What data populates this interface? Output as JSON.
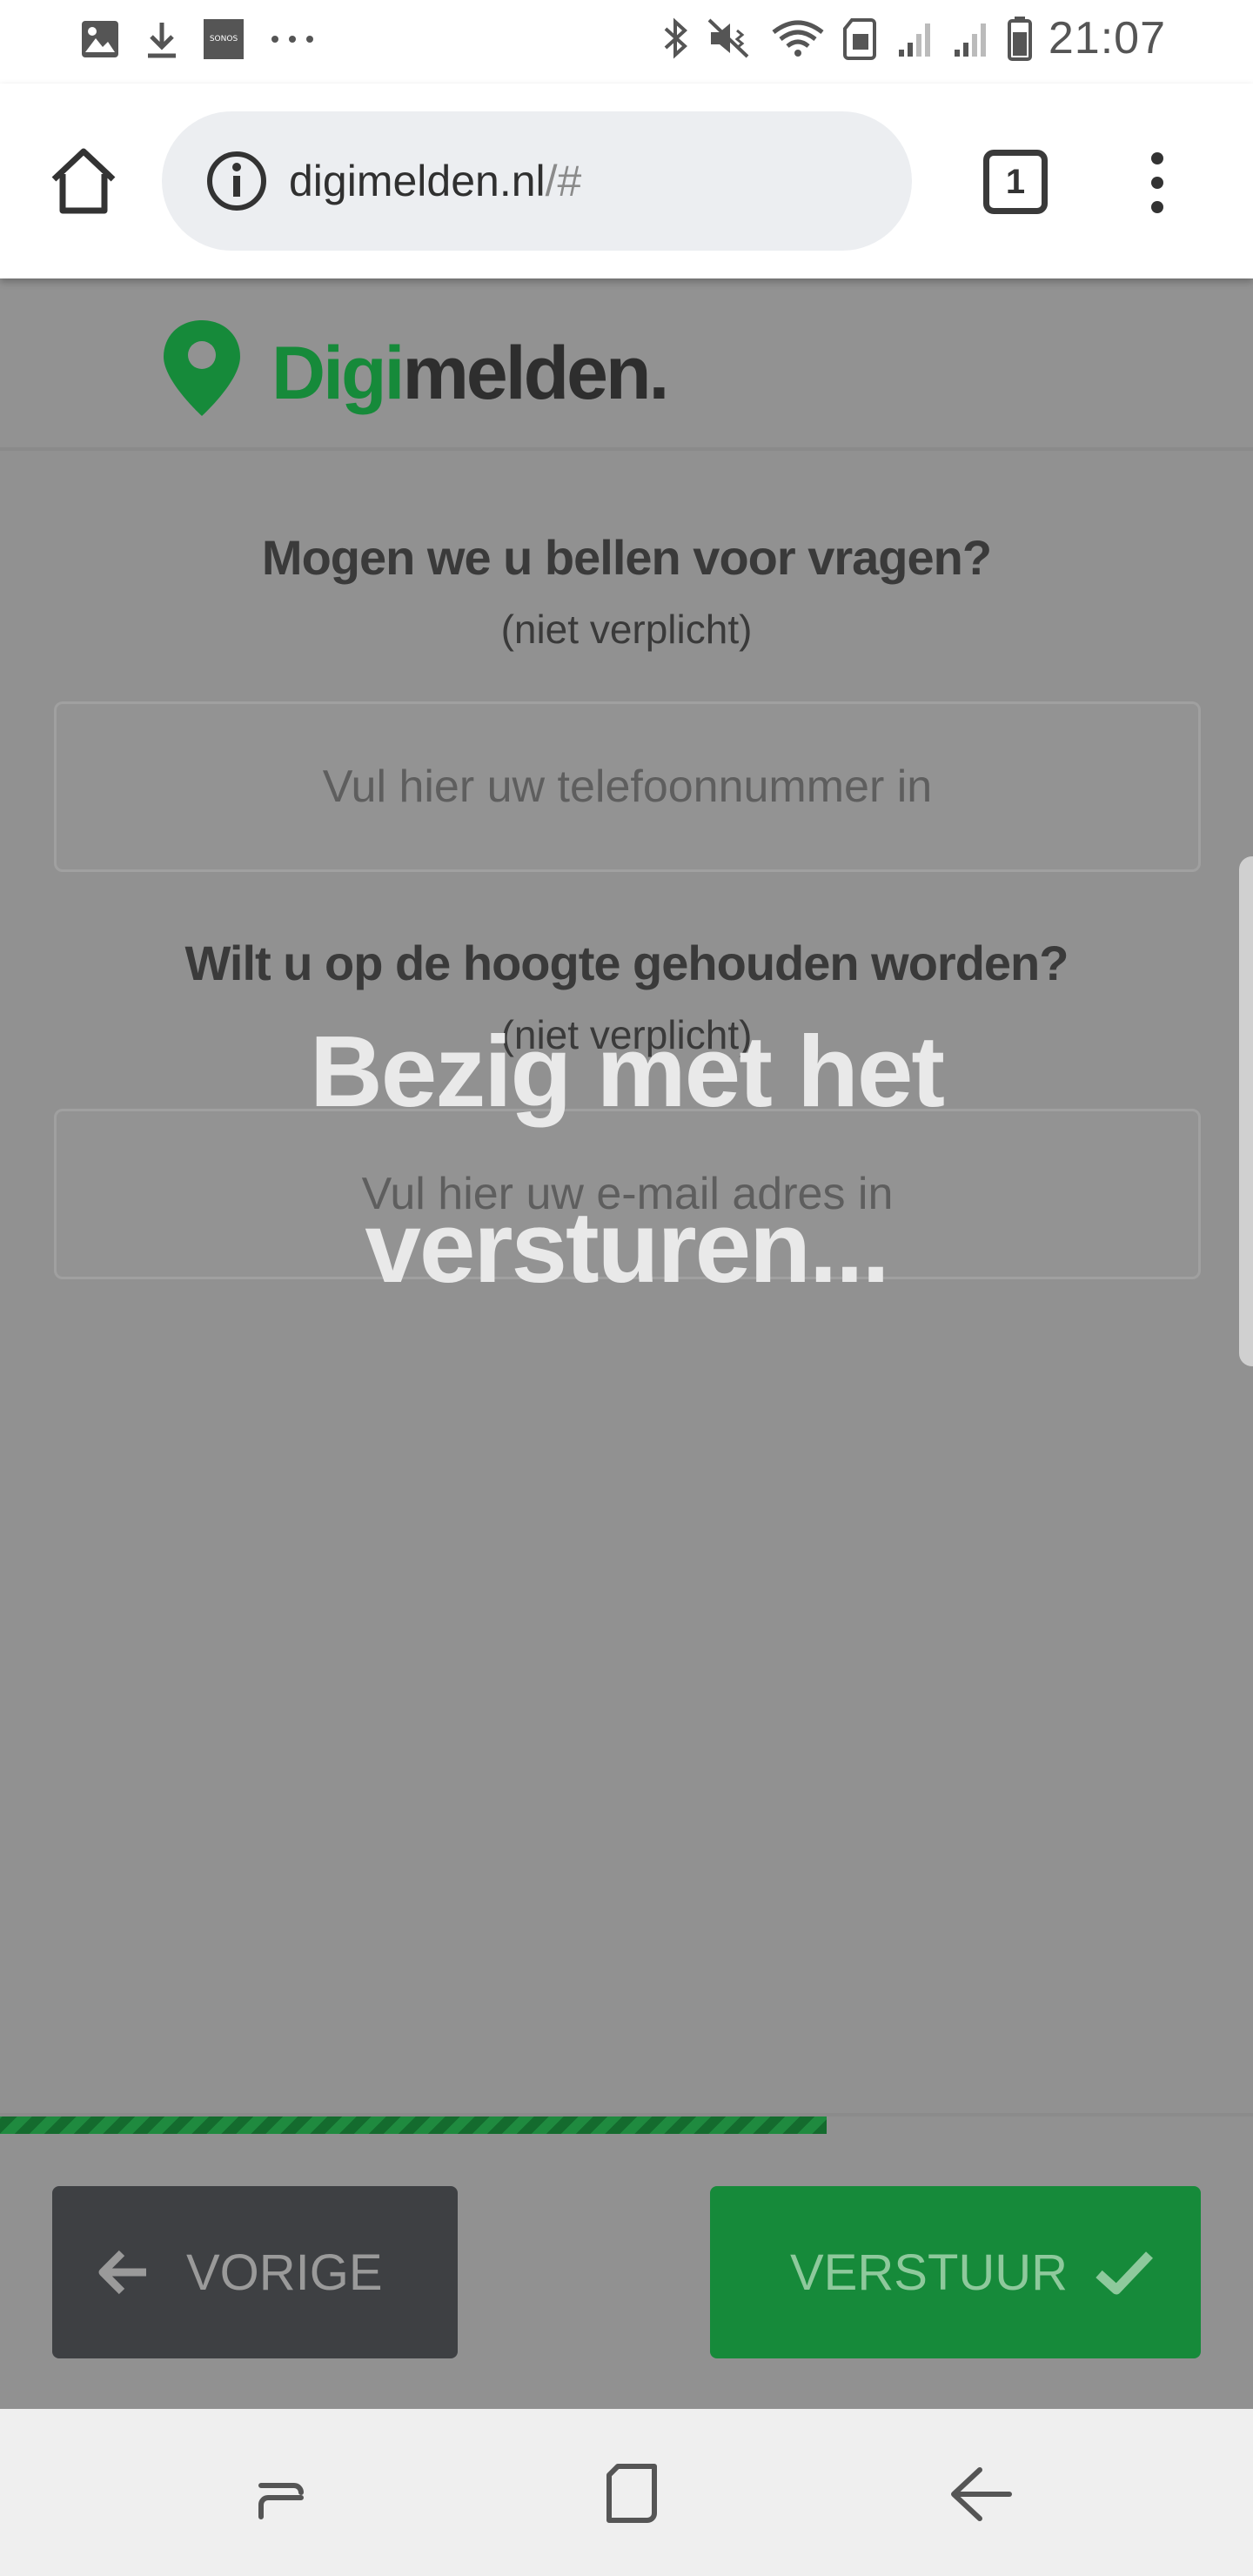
{
  "status_bar": {
    "time": "21:07",
    "left_icons": [
      "image-icon",
      "download-icon",
      "sonos-icon",
      "more-dots-icon"
    ],
    "sonos_label": "SONOS",
    "right_icons": [
      "bluetooth-icon",
      "mute-vibrate-icon",
      "wifi-icon",
      "sim-icon",
      "signal-1-icon",
      "signal-2-icon",
      "battery-icon"
    ]
  },
  "browser": {
    "url_domain": "digimelden.nl",
    "url_hash": "/#",
    "tab_count": "1",
    "icons": [
      "home-icon",
      "info-icon",
      "tabs-icon",
      "menu-icon"
    ]
  },
  "logo": {
    "part1": "Digi",
    "part2": "melden."
  },
  "form": {
    "phone": {
      "title": "Mogen we u bellen voor vragen?",
      "subtitle": "(niet verplicht)",
      "placeholder": "Vul hier uw telefoonnummer in"
    },
    "email": {
      "title": "Wilt u op de hoogte gehouden worden?",
      "subtitle": "(niet verplicht)",
      "placeholder": "Vul hier uw e-mail adres in"
    }
  },
  "overlay": {
    "line1": "Bezig met het",
    "line2": "versturen..."
  },
  "progress": {
    "fraction": 0.66
  },
  "buttons": {
    "prev_label": "VORIGE",
    "send_label": "VERSTUUR"
  },
  "colors": {
    "brand_green": "#168a3a",
    "overlay_gray": "#919191",
    "dark_button": "#3e4043"
  },
  "nav_bar": {
    "icons": [
      "recent-apps-icon",
      "home-square-icon",
      "back-icon"
    ]
  }
}
